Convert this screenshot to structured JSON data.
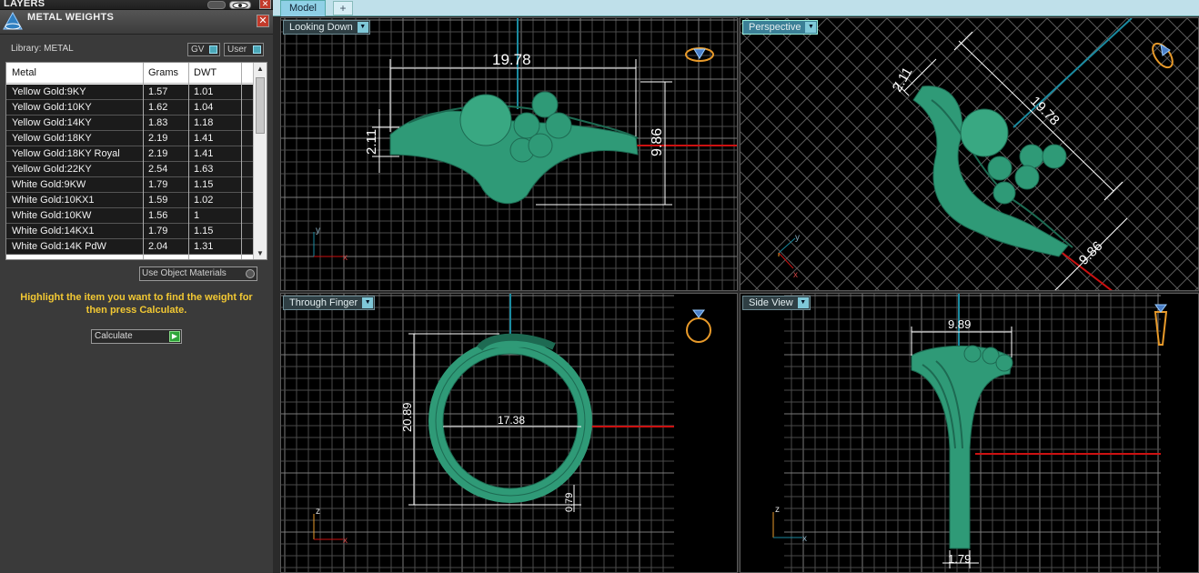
{
  "layers_panel": {
    "title": "LAYERS"
  },
  "metal_weights": {
    "title": "METAL WEIGHTS",
    "library_label": "Library: METAL",
    "toggle_gv": "GV",
    "toggle_user": "User",
    "columns": [
      "Metal",
      "Grams",
      "DWT"
    ],
    "rows": [
      {
        "metal": "Yellow Gold:9KY",
        "grams": "1.57",
        "dwt": "1.01"
      },
      {
        "metal": "Yellow Gold:10KY",
        "grams": "1.62",
        "dwt": "1.04"
      },
      {
        "metal": "Yellow Gold:14KY",
        "grams": "1.83",
        "dwt": "1.18"
      },
      {
        "metal": "Yellow Gold:18KY",
        "grams": "2.19",
        "dwt": "1.41"
      },
      {
        "metal": "Yellow Gold:18KY Royal",
        "grams": "2.19",
        "dwt": "1.41"
      },
      {
        "metal": "Yellow Gold:22KY",
        "grams": "2.54",
        "dwt": "1.63"
      },
      {
        "metal": "White Gold:9KW",
        "grams": "1.79",
        "dwt": "1.15"
      },
      {
        "metal": "White Gold:10KX1",
        "grams": "1.59",
        "dwt": "1.02"
      },
      {
        "metal": "White Gold:10KW",
        "grams": "1.56",
        "dwt": "1"
      },
      {
        "metal": "White Gold:14KX1",
        "grams": "1.79",
        "dwt": "1.15"
      },
      {
        "metal": "White Gold:14K PdW",
        "grams": "2.04",
        "dwt": "1.31"
      }
    ],
    "use_object_materials": "Use Object Materials",
    "hint": "Highlight the item you want to find the weight for then press Calculate.",
    "calculate_label": "Calculate"
  },
  "tabs": {
    "model": "Model",
    "add": "+"
  },
  "viewports": {
    "looking_down": {
      "label": "Looking Down",
      "dim_width": "19.78",
      "dim_height": "9.86",
      "dim_thick": "2.11",
      "axis_v": "y",
      "axis_h": "x"
    },
    "perspective": {
      "label": "Perspective",
      "dim_width": "19.78",
      "dim_height": "9.86",
      "dim_thick": "2.11",
      "axis_v": "y",
      "axis_h": "x"
    },
    "through_finger": {
      "label": "Through Finger",
      "dim_height": "20.89",
      "dim_inner": "17.38",
      "dim_shank": "0.79",
      "axis_v": "z",
      "axis_h": "x"
    },
    "side_view": {
      "label": "Side View",
      "dim_width": "9.89",
      "dim_bottom": "1.79",
      "axis_v": "z",
      "axis_h": "x"
    }
  },
  "colors": {
    "model": "#2f9a77",
    "model_dark": "#1d6a52",
    "grid": "#6a6a6a",
    "axis_red": "#c11",
    "axis_blue": "#1a8aa0",
    "hint": "#f2c833"
  }
}
